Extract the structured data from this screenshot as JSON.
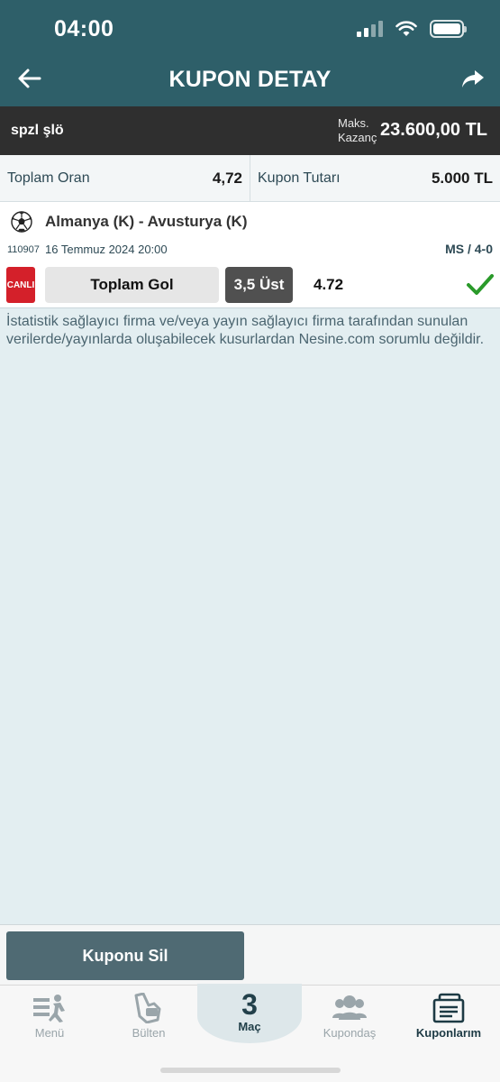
{
  "status_bar": {
    "time": "04:00"
  },
  "header": {
    "title": "KUPON DETAY"
  },
  "coupon": {
    "name": "spzl şlö",
    "max_win_label_line1": "Maks.",
    "max_win_label_line2": "Kazanç",
    "max_win_value": "23.600,00 TL"
  },
  "summary": {
    "total_odds_label": "Toplam Oran",
    "total_odds_value": "4,72",
    "stake_label": "Kupon Tutarı",
    "stake_value": "5.000 TL"
  },
  "match": {
    "teams": "Almanya (K) - Avusturya (K)",
    "code": "110907",
    "date": "16 Temmuz 2024 20:00",
    "result": "MS / 4-0",
    "live_badge": "CANLI",
    "market": "Toplam Gol",
    "pick": "3,5 Üst",
    "odd": "4.72",
    "status_icon": "check-icon"
  },
  "disclaimer": "İstatistik sağlayıcı firma ve/veya yayın sağlayıcı firma tarafından sunulan verilerde/yayınlarda oluşabilecek kusurlardan Nesine.com sorumlu değildir.",
  "actions": {
    "delete_label": "Kuponu Sil"
  },
  "tabbar": {
    "menu": "Menü",
    "bulletin": "Bülten",
    "match_count": "3",
    "match_label": "Maç",
    "kupondas": "Kupondaş",
    "kuponlarim": "Kuponlarım"
  },
  "colors": {
    "header": "#2e5f69",
    "name_bar": "#2f2f2f",
    "live": "#d4202a",
    "success": "#2a9a2a",
    "delete_button": "#4f6a73"
  }
}
